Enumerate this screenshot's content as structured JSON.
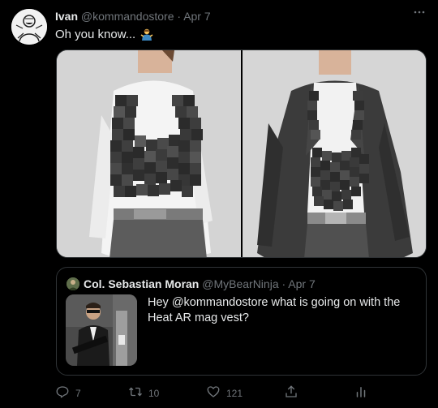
{
  "tweet": {
    "author_name": "Ivan",
    "author_handle": "@kommandostore",
    "separator": "·",
    "timestamp": "Apr 7",
    "text": "Oh you know...",
    "emoji_icon": "person-shrugging-emoji",
    "more_icon": "more-horizontal-icon"
  },
  "quoted_tweet": {
    "author_name": "Col. Sebastian Moran",
    "author_handle": "@MyBearNinja",
    "separator": "·",
    "timestamp": "Apr 7",
    "text": "Hey @kommandostore what is going on with the Heat AR mag vest?"
  },
  "actions": {
    "reply_count": "7",
    "retweet_count": "10",
    "like_count": "121",
    "reply_icon": "reply-icon",
    "retweet_icon": "retweet-icon",
    "like_icon": "heart-icon",
    "share_icon": "share-icon",
    "analytics_icon": "analytics-icon"
  },
  "colors": {
    "background": "#000000",
    "text_primary": "#e7e9ea",
    "text_secondary": "#71767b",
    "border": "#2f3336"
  }
}
